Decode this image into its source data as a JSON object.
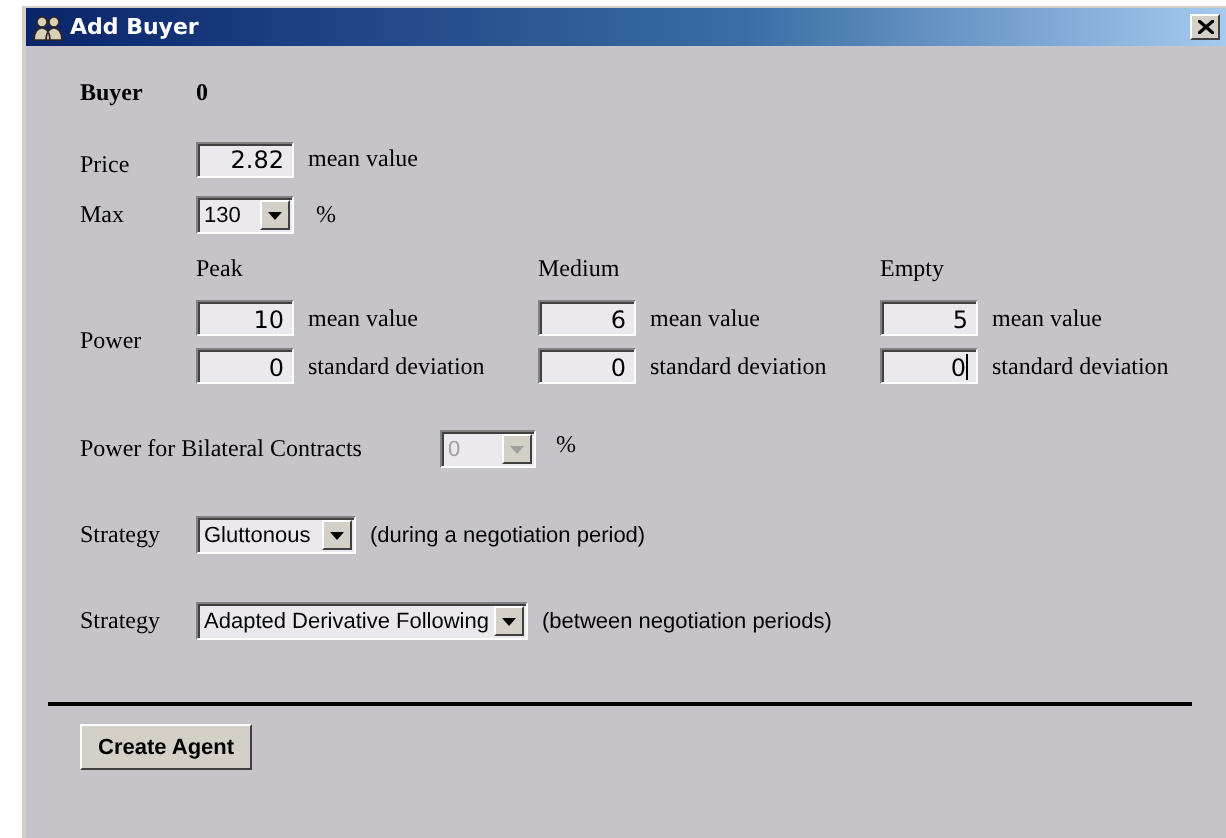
{
  "window": {
    "title": "Add Buyer"
  },
  "buyer": {
    "label": "Buyer",
    "value": "0"
  },
  "price": {
    "label": "Price",
    "value": "2.82",
    "unit": "mean value"
  },
  "max": {
    "label": "Max",
    "value": "130",
    "unit": "%"
  },
  "power": {
    "label": "Power",
    "columns": [
      {
        "heading": "Peak",
        "mean": "10",
        "mean_unit": "mean value",
        "sd": "0",
        "sd_unit": "standard deviation",
        "sd_focused": false
      },
      {
        "heading": "Medium",
        "mean": "6",
        "mean_unit": "mean value",
        "sd": "0",
        "sd_unit": "standard deviation",
        "sd_focused": false
      },
      {
        "heading": "Empty",
        "mean": "5",
        "mean_unit": "mean value",
        "sd": "0",
        "sd_unit": "standard deviation",
        "sd_focused": true
      }
    ]
  },
  "bilateral": {
    "label": "Power for Bilateral Contracts",
    "value": "0",
    "disabled": true,
    "unit": "%"
  },
  "strategies": [
    {
      "label": "Strategy",
      "value": "Gluttonous",
      "note": "(during a negotiation period)"
    },
    {
      "label": "Strategy",
      "value": "Adapted Derivative Following",
      "note": "(between negotiation periods)"
    }
  ],
  "buttons": [
    {
      "label": "Create Agent"
    }
  ]
}
